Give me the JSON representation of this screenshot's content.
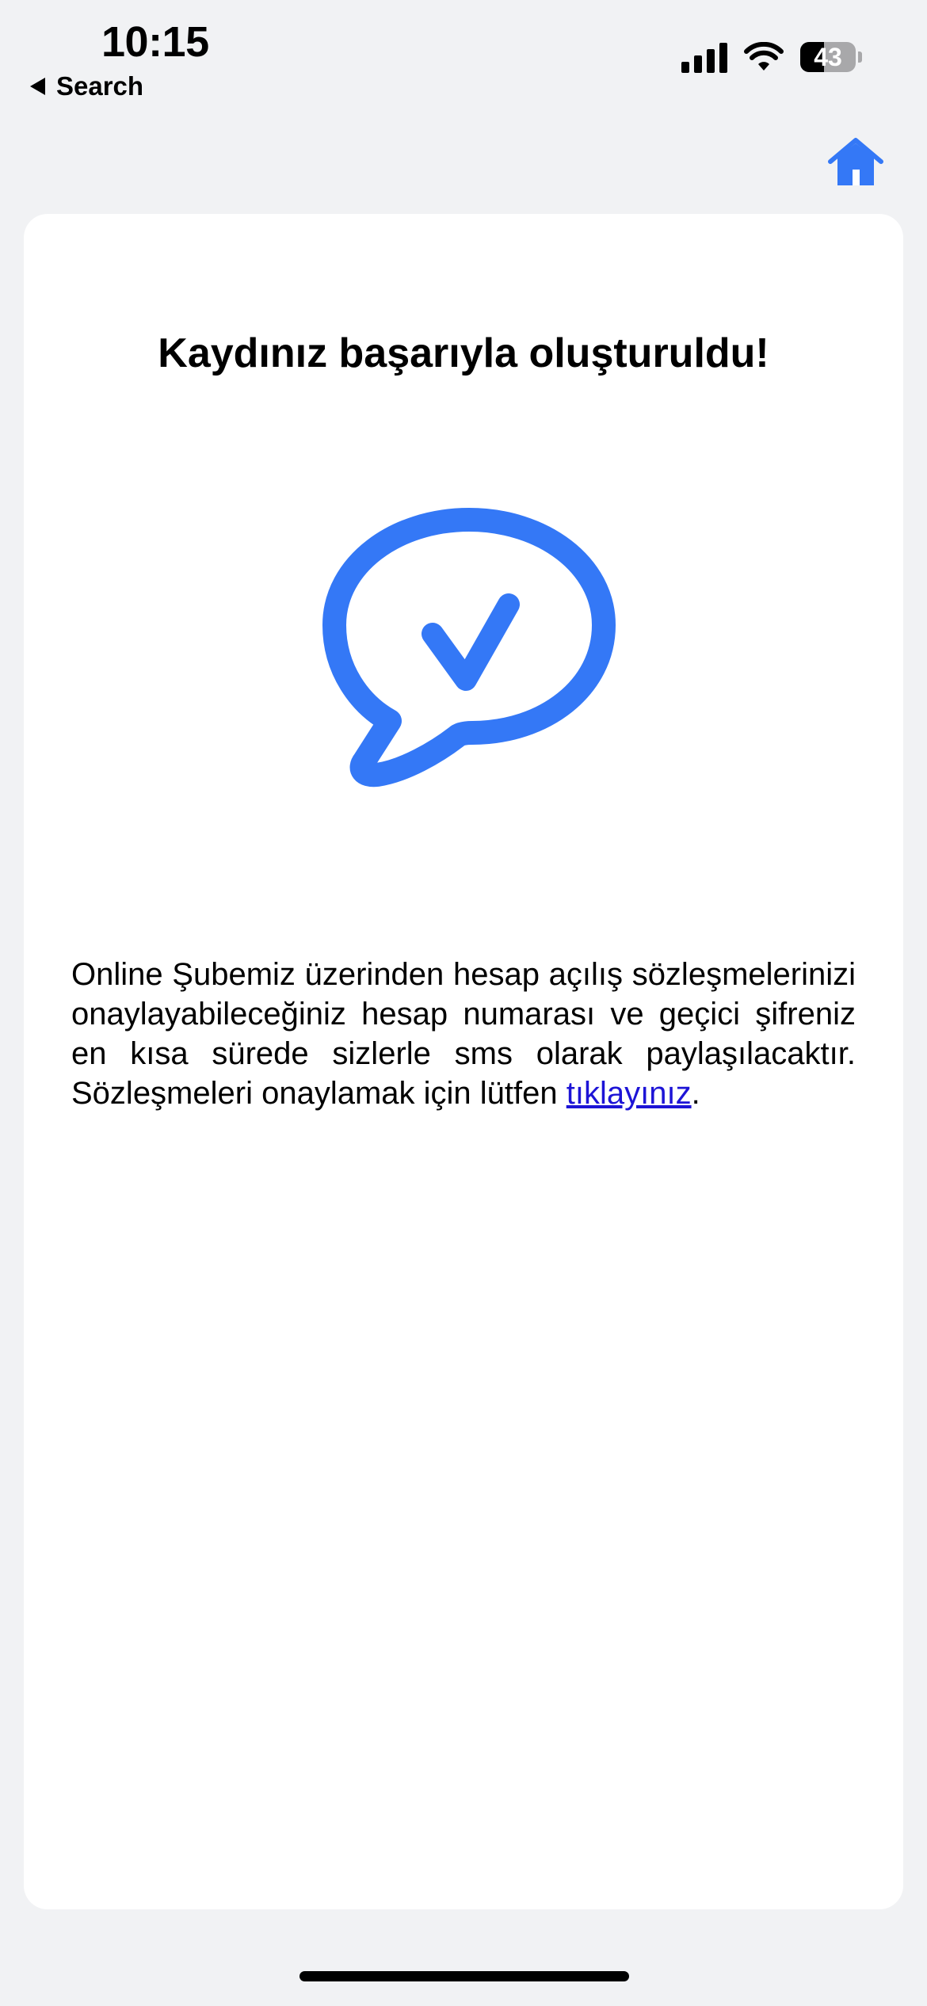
{
  "status_bar": {
    "time": "10:15",
    "back_label": "Search",
    "battery_level": "43"
  },
  "header": {
    "home_icon": "home-icon"
  },
  "card": {
    "title": "Kaydınız başarıyla oluşturuldu!",
    "icon": "speech-bubble-check-icon",
    "message_part1": "Online Şubemiz üzerinden hesap açılış sözleşmelerinizi onaylayabileceğiniz hesap numarası ve geçici şifreniz en kısa sürede sizlerle sms olarak paylaşılacaktır. Sözleşmeleri onaylamak için lütfen ",
    "link_text": "tıklayınız",
    "message_part2": "."
  },
  "colors": {
    "accent": "#3478f6",
    "link": "#1d14d6",
    "background": "#f1f2f4"
  }
}
